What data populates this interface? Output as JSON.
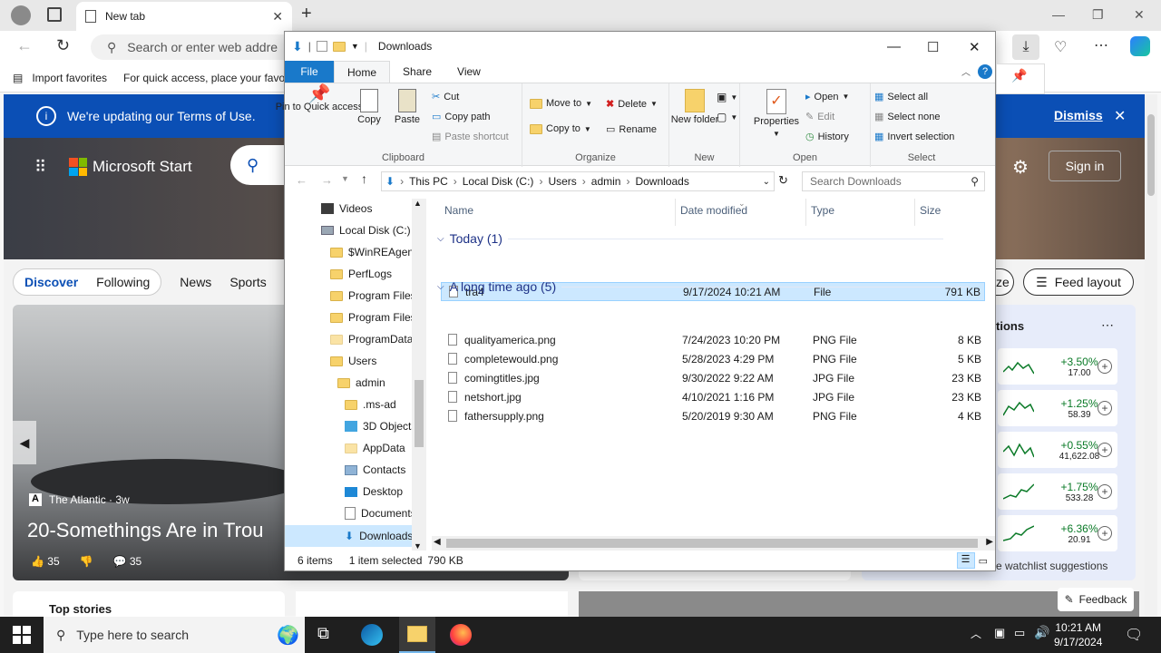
{
  "browser": {
    "tab_title": "New tab",
    "address_placeholder": "Search or enter web addre",
    "favorites": [
      "Import favorites",
      "For quick access, place your favo"
    ]
  },
  "explorer": {
    "window_title": "Downloads",
    "tabs": {
      "file": "File",
      "home": "Home",
      "share": "Share",
      "view": "View"
    },
    "ribbon": {
      "pin": "Pin to Quick access",
      "copy": "Copy",
      "paste": "Paste",
      "cut": "Cut",
      "copy_path": "Copy path",
      "paste_shortcut": "Paste shortcut",
      "clipboard": "Clipboard",
      "move_to": "Move to",
      "copy_to": "Copy to",
      "delete": "Delete",
      "rename": "Rename",
      "organize": "Organize",
      "new_folder": "New folder",
      "new": "New",
      "properties": "Properties",
      "open": "Open",
      "edit": "Edit",
      "history": "History",
      "open_group": "Open",
      "select_all": "Select all",
      "select_none": "Select none",
      "invert_selection": "Invert selection",
      "select": "Select"
    },
    "path": [
      "This PC",
      "Local Disk (C:)",
      "Users",
      "admin",
      "Downloads"
    ],
    "search_placeholder": "Search Downloads",
    "nav": [
      {
        "label": "Videos"
      },
      {
        "label": "Local Disk (C:)"
      },
      {
        "label": "$WinREAgent"
      },
      {
        "label": "PerfLogs"
      },
      {
        "label": "Program Files"
      },
      {
        "label": "Program Files"
      },
      {
        "label": "ProgramData"
      },
      {
        "label": "Users"
      },
      {
        "label": "admin"
      },
      {
        "label": ".ms-ad"
      },
      {
        "label": "3D Objects"
      },
      {
        "label": "AppData"
      },
      {
        "label": "Contacts"
      },
      {
        "label": "Desktop"
      },
      {
        "label": "Documents"
      },
      {
        "label": "Downloads"
      }
    ],
    "columns": {
      "name": "Name",
      "date": "Date modified",
      "type": "Type",
      "size": "Size"
    },
    "groups": {
      "today": "Today (1)",
      "old": "A long time ago (5)"
    },
    "files_today": [
      {
        "name": "tra4",
        "date": "9/17/2024 10:21 AM",
        "type": "File",
        "size": "791 KB"
      }
    ],
    "files_old": [
      {
        "name": "qualityamerica.png",
        "date": "7/24/2023 10:20 PM",
        "type": "PNG File",
        "size": "8 KB"
      },
      {
        "name": "completewould.png",
        "date": "5/28/2023 4:29 PM",
        "type": "PNG File",
        "size": "5 KB"
      },
      {
        "name": "comingtitles.jpg",
        "date": "9/30/2022 9:22 AM",
        "type": "JPG File",
        "size": "23 KB"
      },
      {
        "name": "netshort.jpg",
        "date": "4/10/2021 1:16 PM",
        "type": "JPG File",
        "size": "23 KB"
      },
      {
        "name": "fathersupply.png",
        "date": "5/20/2019 9:30 AM",
        "type": "PNG File",
        "size": "4 KB"
      }
    ],
    "status": {
      "items": "6 items",
      "selected": "1 item selected",
      "size": "790 KB"
    }
  },
  "msstart": {
    "banner": "We're updating our Terms of Use.",
    "dismiss": "Dismiss",
    "logo": "Microsoft Start",
    "signin": "Sign in",
    "nav": [
      "Discover",
      "Following",
      "News",
      "Sports"
    ],
    "feed_layout": "Feed layout",
    "source": "The Atlantic · 3w",
    "headline": "20-Somethings Are in Trou",
    "likes": "35",
    "comments": "35",
    "watchlist_title": "tions",
    "stocks": [
      {
        "pct": "+3.50%",
        "price": "17.00"
      },
      {
        "pct": "+1.25%",
        "price": "58.39"
      },
      {
        "pct": "+0.55%",
        "price": "41,622.08"
      },
      {
        "pct": "+1.75%",
        "price": "533.28"
      },
      {
        "pct": "+6.36%",
        "price": "20.91"
      }
    ],
    "watchlist_suggestions": "e watchlist suggestions",
    "top_stories": "Top stories",
    "feedback": "Feedback"
  },
  "taskbar": {
    "search": "Type here to search",
    "time": "10:21 AM",
    "date": "9/17/2024"
  },
  "colors": {
    "accent": "#1979ca",
    "banner": "#0b4fb5",
    "selection": "#cce8ff"
  }
}
